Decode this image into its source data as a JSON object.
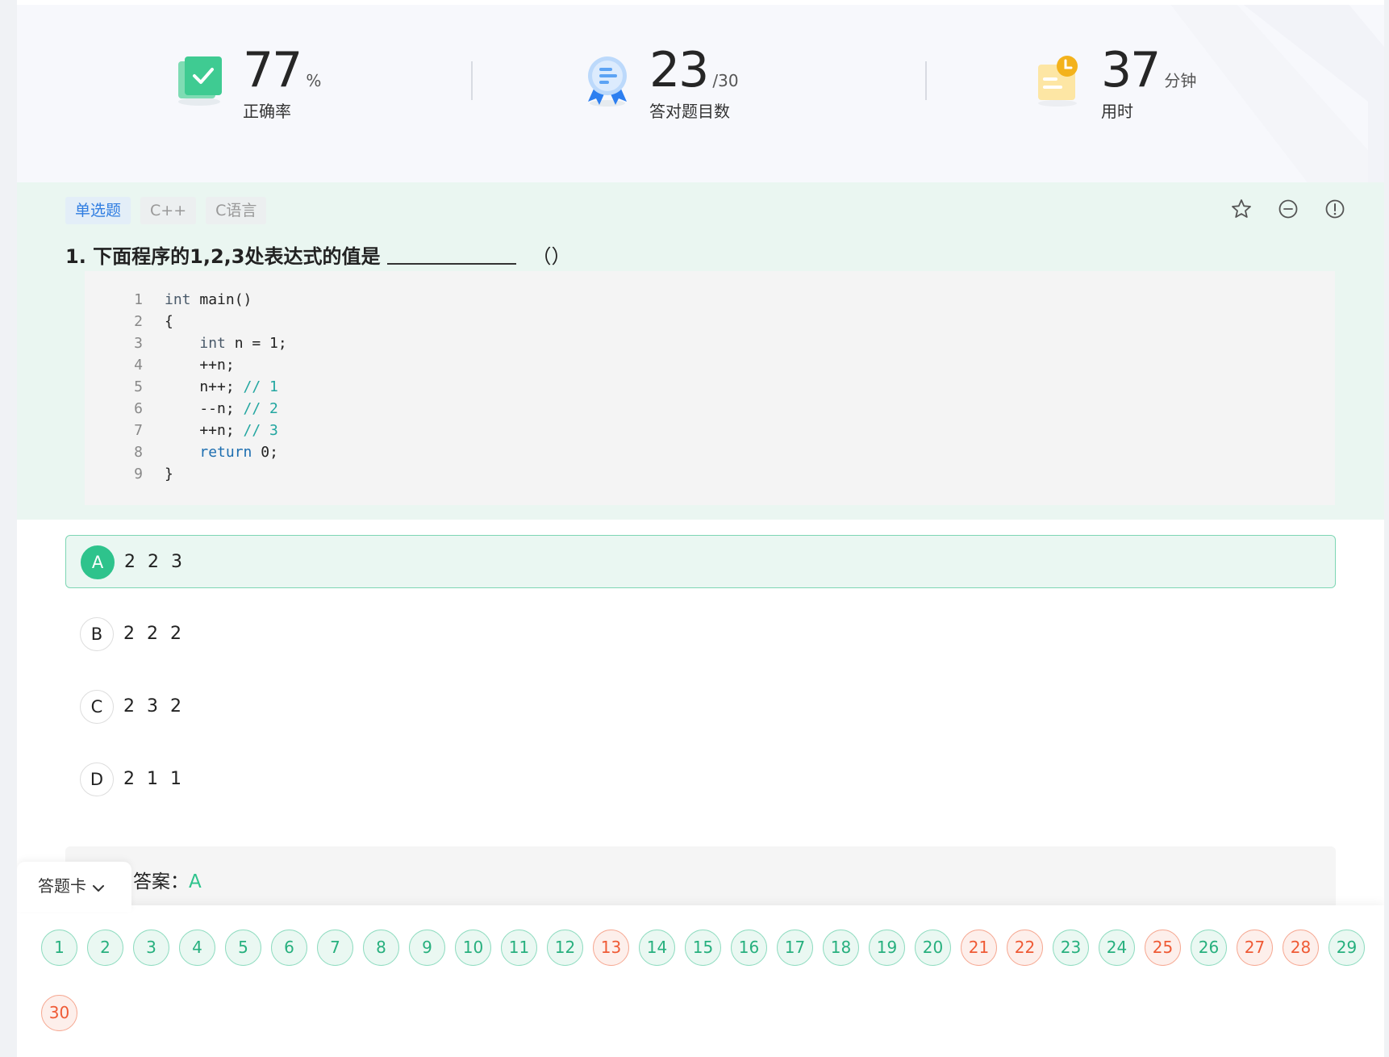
{
  "stats": {
    "accuracy": {
      "value": "77",
      "unit": "%",
      "label": "正确率"
    },
    "correct": {
      "value": "23",
      "unit": "/30",
      "label": "答对题目数"
    },
    "time": {
      "value": "37",
      "unit": "分钟",
      "label": "用时"
    }
  },
  "question": {
    "tags": [
      "单选题",
      "C++",
      "C语言"
    ],
    "title": "1. 下面程序的1,2,3处表达式的值是",
    "paren": "（）",
    "code_lines": [
      {
        "n": "1",
        "parts": [
          [
            "kw",
            "int"
          ],
          [
            "t",
            " main()"
          ]
        ]
      },
      {
        "n": "2",
        "parts": [
          [
            "t",
            "{"
          ]
        ]
      },
      {
        "n": "3",
        "parts": [
          [
            "t",
            "    "
          ],
          [
            "kw",
            "int"
          ],
          [
            "t",
            " n = 1;"
          ]
        ]
      },
      {
        "n": "4",
        "parts": [
          [
            "t",
            "    ++n;"
          ]
        ]
      },
      {
        "n": "5",
        "parts": [
          [
            "t",
            "    n++; "
          ],
          [
            "cm",
            "// 1"
          ]
        ]
      },
      {
        "n": "6",
        "parts": [
          [
            "t",
            "    --n; "
          ],
          [
            "cm",
            "// 2"
          ]
        ]
      },
      {
        "n": "7",
        "parts": [
          [
            "t",
            "    ++n; "
          ],
          [
            "cm",
            "// 3"
          ]
        ]
      },
      {
        "n": "8",
        "parts": [
          [
            "t",
            "    "
          ],
          [
            "kw2",
            "return"
          ],
          [
            "t",
            " 0;"
          ]
        ]
      },
      {
        "n": "9",
        "parts": [
          [
            "t",
            "}"
          ]
        ]
      }
    ]
  },
  "options": [
    {
      "letter": "A",
      "text": "2 2 3",
      "selected": true
    },
    {
      "letter": "B",
      "text": "2 2 2",
      "selected": false
    },
    {
      "letter": "C",
      "text": "2 3 2",
      "selected": false
    },
    {
      "letter": "D",
      "text": "2 1 1",
      "selected": false
    }
  ],
  "answer": {
    "label": "答案：",
    "value": "A"
  },
  "answer_sheet": {
    "label": "答题卡",
    "items": [
      {
        "n": "1",
        "s": "right"
      },
      {
        "n": "2",
        "s": "right"
      },
      {
        "n": "3",
        "s": "right"
      },
      {
        "n": "4",
        "s": "right"
      },
      {
        "n": "5",
        "s": "right"
      },
      {
        "n": "6",
        "s": "right"
      },
      {
        "n": "7",
        "s": "right"
      },
      {
        "n": "8",
        "s": "right"
      },
      {
        "n": "9",
        "s": "right"
      },
      {
        "n": "10",
        "s": "right"
      },
      {
        "n": "11",
        "s": "right"
      },
      {
        "n": "12",
        "s": "right"
      },
      {
        "n": "13",
        "s": "wrong"
      },
      {
        "n": "14",
        "s": "right"
      },
      {
        "n": "15",
        "s": "right"
      },
      {
        "n": "16",
        "s": "right"
      },
      {
        "n": "17",
        "s": "right"
      },
      {
        "n": "18",
        "s": "right"
      },
      {
        "n": "19",
        "s": "right"
      },
      {
        "n": "20",
        "s": "right"
      },
      {
        "n": "21",
        "s": "wrong"
      },
      {
        "n": "22",
        "s": "wrong"
      },
      {
        "n": "23",
        "s": "right"
      },
      {
        "n": "24",
        "s": "right"
      },
      {
        "n": "25",
        "s": "wrong"
      },
      {
        "n": "26",
        "s": "right"
      },
      {
        "n": "27",
        "s": "wrong"
      },
      {
        "n": "28",
        "s": "wrong"
      },
      {
        "n": "29",
        "s": "right"
      },
      {
        "n": "30",
        "s": "wrong"
      }
    ]
  },
  "colors": {
    "accent": "#2ec38c",
    "wrong": "#ef5a35",
    "link": "#2f7de1"
  },
  "icons": [
    "check-card-icon",
    "award-ribbon-icon",
    "clock-note-icon",
    "star-icon",
    "minus-circle-icon",
    "alert-circle-icon",
    "chevron-down-icon"
  ]
}
